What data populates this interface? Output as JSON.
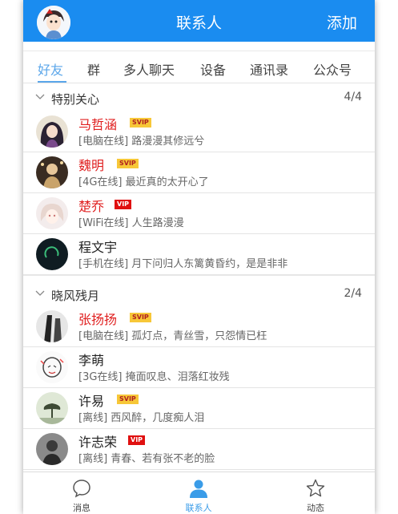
{
  "header": {
    "title": "联系人",
    "add_label": "添加"
  },
  "tabs": [
    {
      "label": "好友",
      "active": true
    },
    {
      "label": "群"
    },
    {
      "label": "多人聊天"
    },
    {
      "label": "设备"
    },
    {
      "label": "通讯录"
    },
    {
      "label": "公众号"
    }
  ],
  "groups": [
    {
      "name": "特别关心",
      "count": "4/4",
      "contacts": [
        {
          "name": "马哲涵",
          "badge": "SVIP",
          "status": "[电脑在线] 路漫漫其修远兮"
        },
        {
          "name": "魏明",
          "badge": "SVIP",
          "status": "[4G在线] 最近真的太开心了"
        },
        {
          "name": "楚乔",
          "badge": "VIP",
          "status": "[WiFi在线] 人生路漫漫"
        },
        {
          "name": "程文宇",
          "badge": "",
          "status": "[手机在线] 月下问归人东篱黄昏约，是是非非"
        }
      ]
    },
    {
      "name": "晓风残月",
      "count": "2/4",
      "contacts": [
        {
          "name": "张扬扬",
          "badge": "SVIP",
          "status": "[电脑在线] 孤灯点，青丝雪，只怨情已枉"
        },
        {
          "name": "李萌",
          "badge": "",
          "status": "[3G在线] 掩面叹息、泪落红妆残"
        },
        {
          "name": "许易",
          "badge": "SVIP",
          "status": "[离线] 西风醉，几度痴人泪"
        },
        {
          "name": "许志荣",
          "badge": "VIP",
          "status": "[离线] 青春、若有张不老的脸"
        }
      ]
    }
  ],
  "bottom_nav": [
    {
      "label": "消息",
      "icon": "chat-bubble-icon"
    },
    {
      "label": "联系人",
      "icon": "person-icon",
      "active": true
    },
    {
      "label": "动态",
      "icon": "star-icon"
    }
  ],
  "colors": {
    "brand": "#1a8cf0",
    "active_tab": "#5aa6ea",
    "vip_name": "#e02020",
    "svip_badge": "#f7c738",
    "vip_badge": "#e01010"
  }
}
